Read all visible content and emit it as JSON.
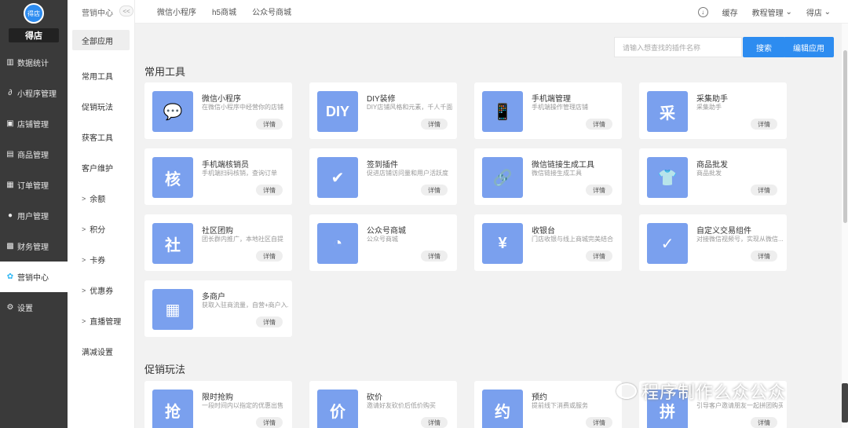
{
  "sidebar": {
    "logo": "得店",
    "shop_name": "得店",
    "items": [
      {
        "label": "数据统计",
        "icon": "chart-icon"
      },
      {
        "label": "小程序管理",
        "icon": "link-icon"
      },
      {
        "label": "店铺管理",
        "icon": "shop-icon"
      },
      {
        "label": "商品管理",
        "icon": "goods-icon"
      },
      {
        "label": "订单管理",
        "icon": "order-icon"
      },
      {
        "label": "用户管理",
        "icon": "user-icon"
      },
      {
        "label": "财务管理",
        "icon": "finance-icon"
      },
      {
        "label": "营销中心",
        "icon": "marketing-icon",
        "active": true
      },
      {
        "label": "设置",
        "icon": "settings-icon"
      }
    ]
  },
  "subnav": {
    "title": "营销中心",
    "collapse": "<<",
    "items": [
      {
        "label": "全部应用",
        "active": true
      },
      {
        "label": "常用工具"
      },
      {
        "label": "促销玩法"
      },
      {
        "label": "获客工具"
      },
      {
        "label": "客户维护"
      },
      {
        "label": "余额",
        "chevron": ">"
      },
      {
        "label": "积分",
        "chevron": ">"
      },
      {
        "label": "卡券",
        "chevron": ">"
      },
      {
        "label": "优惠券",
        "chevron": ">"
      },
      {
        "label": "直播管理",
        "chevron": ">"
      },
      {
        "label": "满减设置"
      }
    ]
  },
  "topbar": {
    "tabs": [
      "微信小程序",
      "h5商城",
      "公众号商城"
    ],
    "download_icon": "download-icon",
    "cache": "缓存",
    "tutorial": "教程管理",
    "user": "得店"
  },
  "toolbar": {
    "search_placeholder": "请输入想查找的插件名称",
    "search_button": "搜索",
    "edit_button": "编辑应用"
  },
  "sections": [
    {
      "title": "常用工具"
    },
    {
      "title": "促销玩法"
    }
  ],
  "cards": [
    {
      "title": "微信小程序",
      "desc": "在微信小程序中经营你的店铺",
      "detail": "详情",
      "icon": "wechat-icon",
      "glyph": "💬"
    },
    {
      "title": "DIY装修",
      "desc": "DIY店铺风格和元素，千人千面",
      "detail": "详情",
      "icon": "diy-icon",
      "glyph": "DIY"
    },
    {
      "title": "手机端管理",
      "desc": "手机端操作管理店铺",
      "detail": "详情",
      "icon": "phone-icon",
      "glyph": "📱"
    },
    {
      "title": "采集助手",
      "desc": "采集助手",
      "detail": "详情",
      "icon": "collect-icon",
      "glyph": "采"
    },
    {
      "title": "手机端核销员",
      "desc": "手机端扫码核销，查询订单",
      "detail": "详情",
      "icon": "verify-icon",
      "glyph": "核"
    },
    {
      "title": "签到插件",
      "desc": "促进店铺访问量和用户活跃度",
      "detail": "详情",
      "icon": "calendar-icon",
      "glyph": "✔"
    },
    {
      "title": "微信链接生成工具",
      "desc": "微信链接生成工具",
      "detail": "详情",
      "icon": "chain-icon",
      "glyph": "🔗"
    },
    {
      "title": "商品批发",
      "desc": "商品批发",
      "detail": "详情",
      "icon": "wholesale-icon",
      "glyph": "👕"
    },
    {
      "title": "社区团购",
      "desc": "团长群内推广，本地社区自提",
      "detail": "详情",
      "icon": "bag-icon",
      "glyph": "社"
    },
    {
      "title": "公众号商城",
      "desc": "公众号商城",
      "detail": "详情",
      "icon": "circle-icon",
      "glyph": "◔"
    },
    {
      "title": "收银台",
      "desc": "门店收银与线上商城完美结合",
      "detail": "详情",
      "icon": "cashier-icon",
      "glyph": "¥"
    },
    {
      "title": "自定义交易组件",
      "desc": "对接微信视频号，实现从微信...",
      "detail": "详情",
      "icon": "component-icon",
      "glyph": "✓"
    },
    {
      "title": "多商户",
      "desc": "获取入驻商流量，自营+商户入...",
      "detail": "详情",
      "icon": "store-icon",
      "glyph": "▦"
    },
    {
      "title": "限时抢购",
      "desc": "一段时间内以指定的优惠出售",
      "detail": "详情",
      "icon": "clock-icon",
      "glyph": "抢"
    },
    {
      "title": "砍价",
      "desc": "邀请好友砍价后低价购买",
      "detail": "详情",
      "icon": "knife-icon",
      "glyph": "价"
    },
    {
      "title": "预约",
      "desc": "提前线下消费或服务",
      "detail": "详情",
      "icon": "reserve-icon",
      "glyph": "约"
    },
    {
      "title": "",
      "desc": "引导客户邀请朋友一起拼团购买",
      "detail": "详情",
      "icon": "group-icon",
      "glyph": "拼"
    }
  ],
  "watermark": "程序制作么众公众"
}
